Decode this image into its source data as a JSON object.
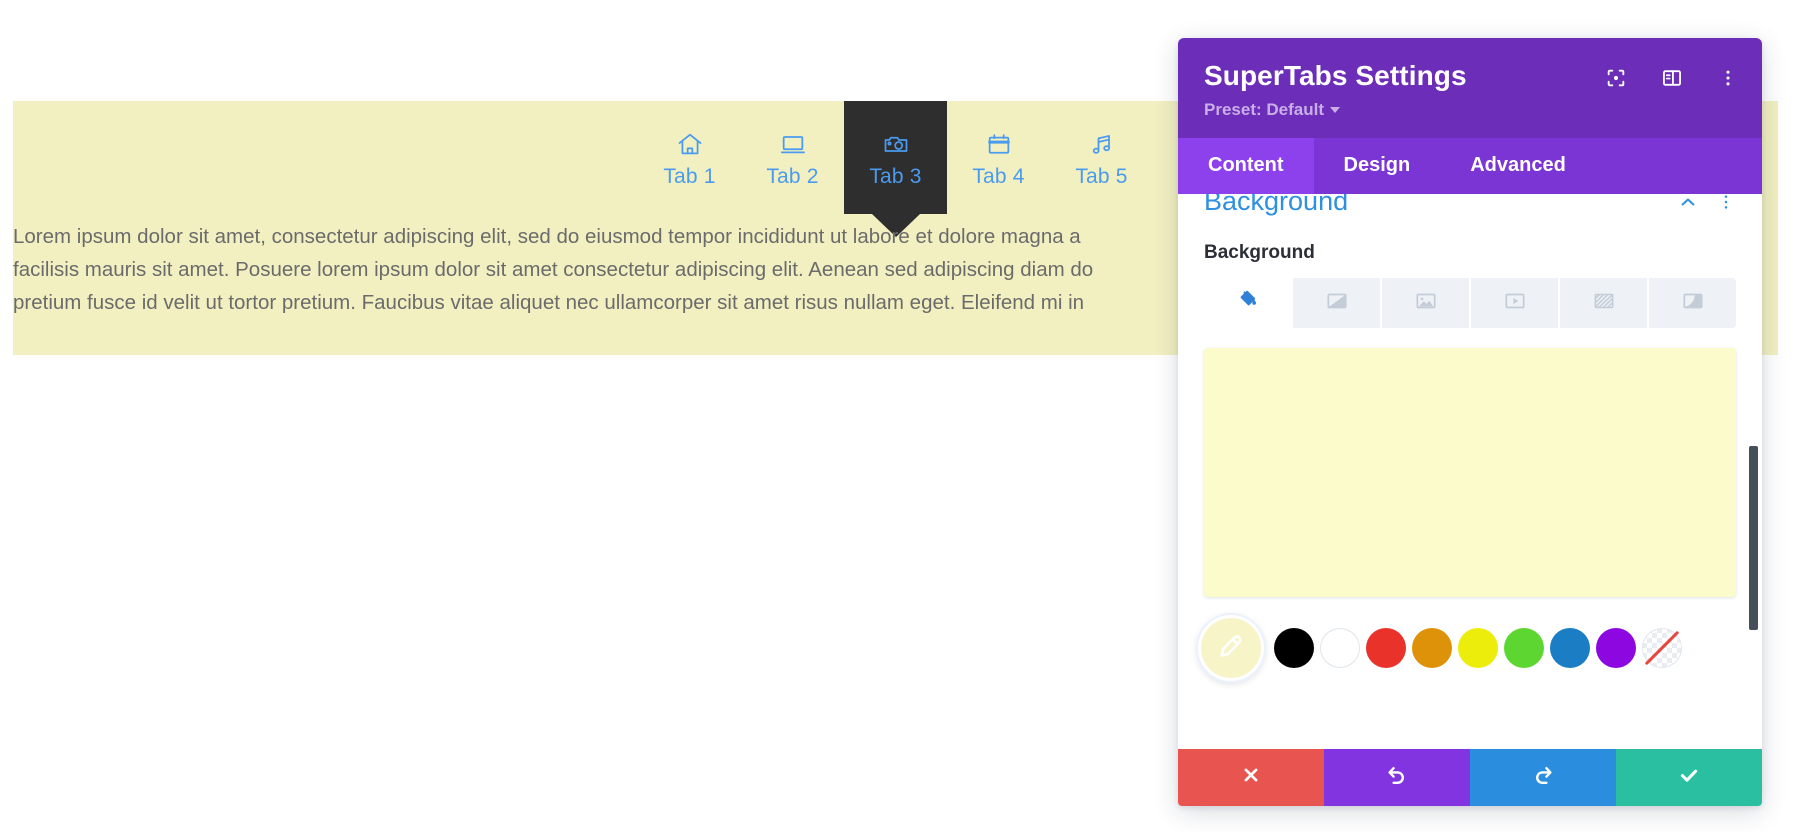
{
  "page": {
    "module_background_color": "#f2f0c1",
    "tab_active_background": "#2e2e2e",
    "tab_link_color": "#4a9bf0",
    "tabs": [
      {
        "label": "Tab 1",
        "icon": "home-icon"
      },
      {
        "label": "Tab 2",
        "icon": "laptop-icon"
      },
      {
        "label": "Tab 3",
        "icon": "camera-icon"
      },
      {
        "label": "Tab 4",
        "icon": "calendar-icon"
      },
      {
        "label": "Tab 5",
        "icon": "music-note-icon"
      }
    ],
    "active_tab_index": 2,
    "body_lines": [
      "Lorem ipsum dolor sit amet, consectetur adipiscing elit, sed do eiusmod tempor incididunt ut labore et dolore magna a",
      "facilisis mauris sit amet. Posuere lorem ipsum dolor sit amet consectetur adipiscing elit. Aenean sed adipiscing diam do",
      "pretium fusce id velit ut tortor pretium. Faucibus vitae aliquet nec ullamcorper sit amet risus nullam eget. Eleifend mi in"
    ]
  },
  "panel": {
    "title": "SuperTabs Settings",
    "preset_label": "Preset: Default",
    "header_color": "#6c2eb9",
    "header_icons": [
      {
        "name": "focus-icon"
      },
      {
        "name": "layout-panel-icon"
      },
      {
        "name": "more-vertical-icon"
      }
    ],
    "tabs": [
      {
        "label": "Content",
        "active": true
      },
      {
        "label": "Design",
        "active": false
      },
      {
        "label": "Advanced",
        "active": false
      }
    ],
    "tab_active_color": "#8c41ed",
    "tab_bar_color": "#7b35d4",
    "section": {
      "title": "Background",
      "collapsed": false,
      "field_label": "Background",
      "background_types": [
        {
          "name": "background-color-icon",
          "active": true
        },
        {
          "name": "background-gradient-icon",
          "active": false
        },
        {
          "name": "background-image-icon",
          "active": false
        },
        {
          "name": "background-video-icon",
          "active": false
        },
        {
          "name": "background-pattern-icon",
          "active": false
        },
        {
          "name": "background-mask-icon",
          "active": false
        }
      ],
      "selected_color": "#fcfbcc",
      "swatches": [
        {
          "name": "eyedropper",
          "color": "#f7f5c8"
        },
        {
          "name": "black",
          "color": "#000000"
        },
        {
          "name": "white",
          "color": "#ffffff"
        },
        {
          "name": "red",
          "color": "#e8322a"
        },
        {
          "name": "orange",
          "color": "#dd9209"
        },
        {
          "name": "yellow",
          "color": "#eded0b"
        },
        {
          "name": "green",
          "color": "#5ed632"
        },
        {
          "name": "blue",
          "color": "#1b7dc4"
        },
        {
          "name": "purple",
          "color": "#8c07e0"
        },
        {
          "name": "transparent",
          "color": "transparent"
        }
      ]
    },
    "footer": [
      {
        "name": "cancel",
        "icon": "close-icon",
        "color": "#e8544f"
      },
      {
        "name": "undo",
        "icon": "undo-icon",
        "color": "#8234e0"
      },
      {
        "name": "redo",
        "icon": "redo-icon",
        "color": "#2a8ddd"
      },
      {
        "name": "save",
        "icon": "check-icon",
        "color": "#2bbfa2"
      }
    ]
  }
}
